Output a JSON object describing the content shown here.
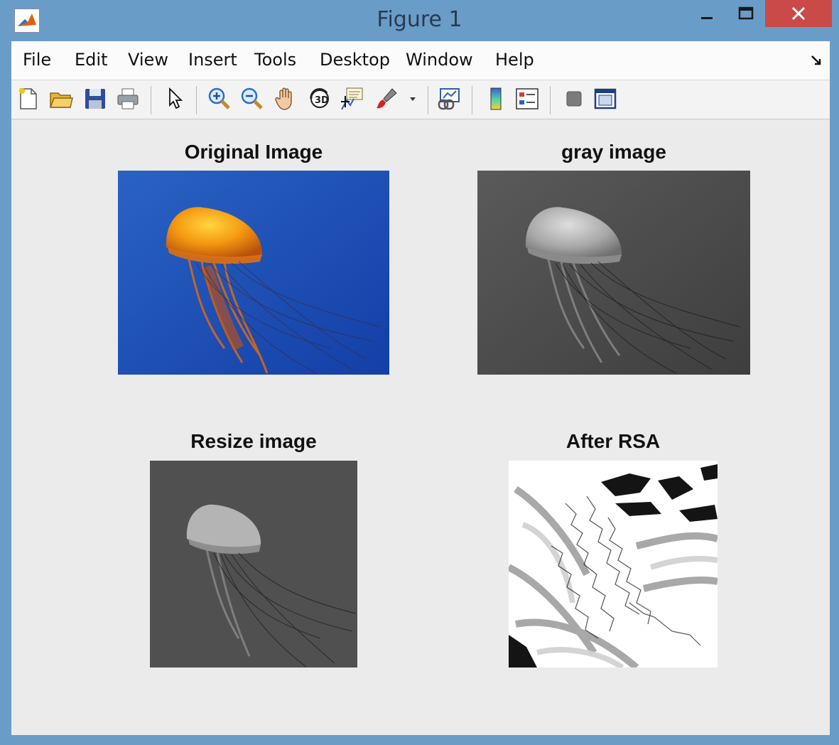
{
  "window": {
    "title": "Figure 1"
  },
  "menu": [
    "File",
    "Edit",
    "View",
    "Insert",
    "Tools",
    "Desktop",
    "Window",
    "Help"
  ],
  "toolbar": [
    {
      "icon": "new-figure-icon"
    },
    {
      "icon": "open-file-icon"
    },
    {
      "icon": "save-icon"
    },
    {
      "icon": "print-icon"
    },
    {
      "icon": "pointer-icon"
    },
    {
      "icon": "zoom-in-icon"
    },
    {
      "icon": "zoom-out-icon"
    },
    {
      "icon": "pan-hand-icon"
    },
    {
      "icon": "rotate-3d-icon"
    },
    {
      "icon": "data-cursor-icon"
    },
    {
      "icon": "brush-icon"
    },
    {
      "icon": "link-plot-icon"
    },
    {
      "icon": "colorbar-icon"
    },
    {
      "icon": "legend-icon"
    },
    {
      "icon": "hide-plot-tools-icon"
    },
    {
      "icon": "show-plot-tools-icon"
    }
  ],
  "subplots": [
    {
      "title": "Original Image",
      "content": "color photograph of an orange jellyfish on a blue background"
    },
    {
      "title": "gray image",
      "content": "grayscale version of the jellyfish"
    },
    {
      "title": "Resize  image",
      "content": "resized grayscale jellyfish"
    },
    {
      "title": "After RSA",
      "content": "noisy black and white encrypted pattern"
    }
  ],
  "colors": {
    "titlebar": "#6a9cc8",
    "close": "#c94a46",
    "figure_bg": "#ebebeb",
    "ocean": "#1f55b8",
    "jelly": "#f08a10"
  }
}
